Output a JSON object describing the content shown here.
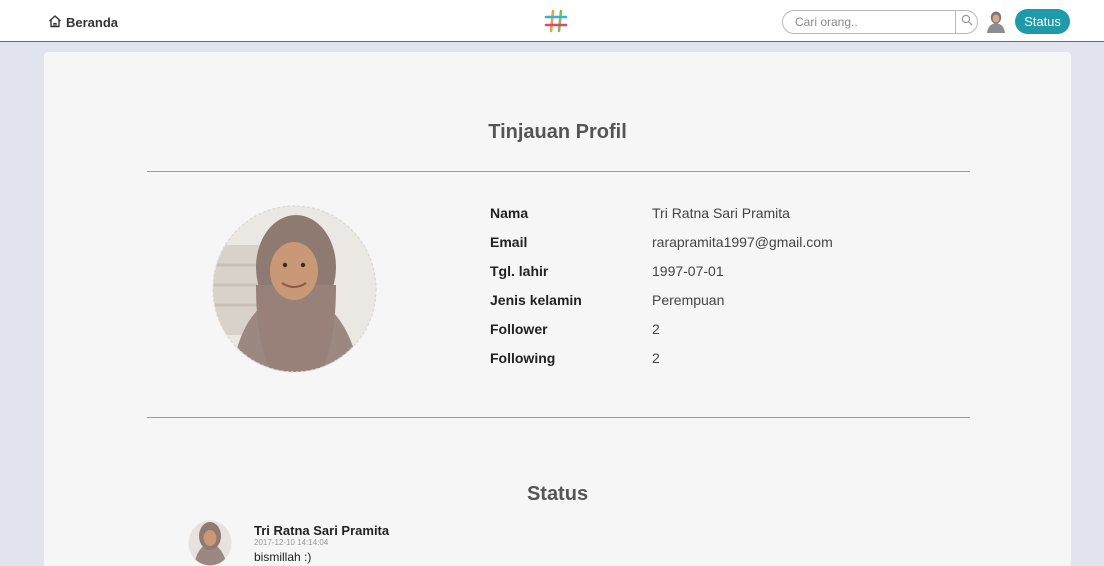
{
  "nav": {
    "home_label": "Beranda",
    "search_placeholder": "Cari orang..",
    "status_label": "Status"
  },
  "profile": {
    "heading": "Tinjauan Profil",
    "fields": [
      {
        "label": "Nama",
        "value": "Tri Ratna Sari Pramita"
      },
      {
        "label": "Email",
        "value": "rarapramita1997@gmail.com"
      },
      {
        "label": "Tgl. lahir",
        "value": "1997-07-01"
      },
      {
        "label": "Jenis kelamin",
        "value": "Perempuan"
      },
      {
        "label": "Follower",
        "value": "2"
      },
      {
        "label": "Following",
        "value": "2"
      }
    ]
  },
  "status": {
    "heading": "Status",
    "posts": [
      {
        "author": "Tri Ratna Sari Pramita",
        "time": "2017-12-10 14:14:04",
        "text": "bismillah :)"
      }
    ]
  },
  "colors": {
    "accent": "#1f9aa8",
    "page_background": "#e1e4ee",
    "card_background": "#f6f6f6"
  },
  "icons": {
    "home": "home-icon",
    "logo": "hashtag-logo-icon",
    "search": "search-icon"
  }
}
